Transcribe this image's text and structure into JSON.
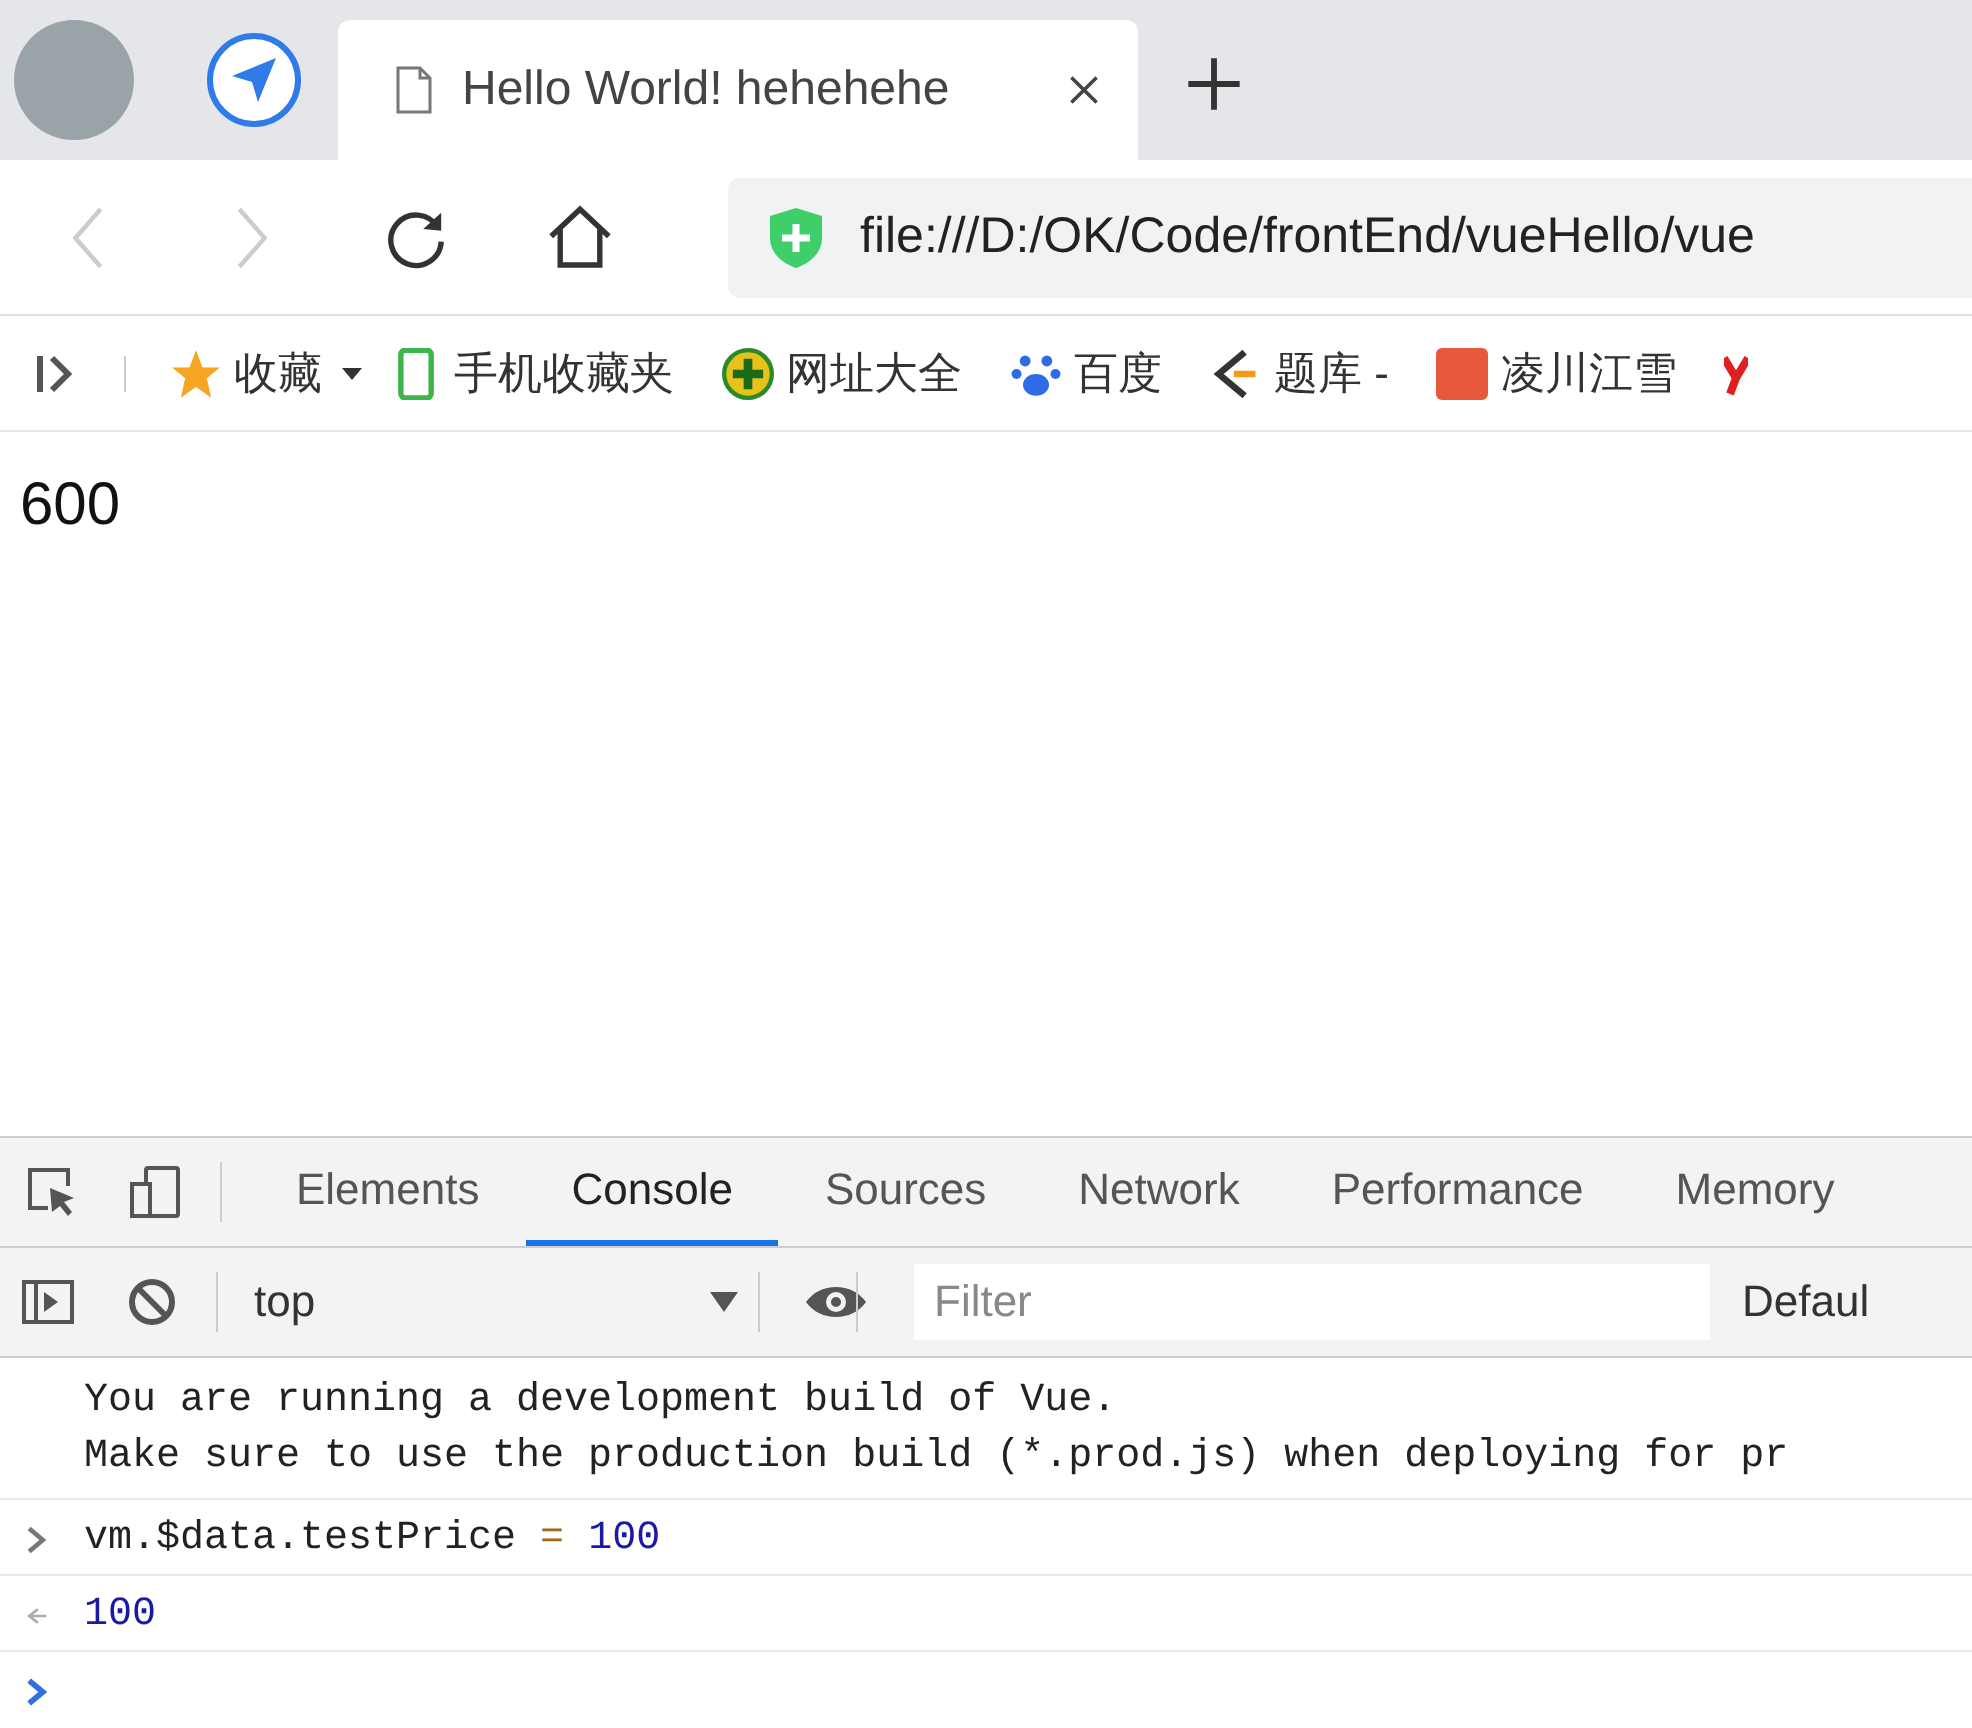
{
  "tab": {
    "title": "Hello World! hehehehe"
  },
  "address_bar": {
    "url": "file:///D:/OK/Code/frontEnd/vueHello/vue"
  },
  "bookmarks": [
    {
      "label": "收藏",
      "kind": "star"
    },
    {
      "label": "手机收藏夹",
      "kind": "phone"
    },
    {
      "label": "网址大全",
      "kind": "plus"
    },
    {
      "label": "百度",
      "kind": "paw"
    },
    {
      "label": "题库 -",
      "kind": "chevron"
    },
    {
      "label": "凌川江雪",
      "kind": "jian"
    }
  ],
  "page": {
    "text": "600"
  },
  "devtools": {
    "tabs": [
      {
        "label": "Elements",
        "selected": false
      },
      {
        "label": "Console",
        "selected": true
      },
      {
        "label": "Sources",
        "selected": false
      },
      {
        "label": "Network",
        "selected": false
      },
      {
        "label": "Performance",
        "selected": false
      },
      {
        "label": "Memory",
        "selected": false
      }
    ],
    "context": "top",
    "filter": {
      "placeholder": "Filter"
    },
    "levels": "Defaul",
    "messages": [
      {
        "kind": "log",
        "lines": [
          "You are running a development build of Vue.",
          "Make sure to use the production build (*.prod.js) when deploying for pr"
        ]
      },
      {
        "kind": "input",
        "parts": [
          {
            "text": "vm.$data.testPrice",
            "kind": "plain"
          },
          {
            "text": "=",
            "kind": "operator"
          },
          {
            "text": "100",
            "kind": "number"
          }
        ]
      },
      {
        "kind": "result",
        "text": "100"
      },
      {
        "kind": "prompt"
      }
    ]
  }
}
